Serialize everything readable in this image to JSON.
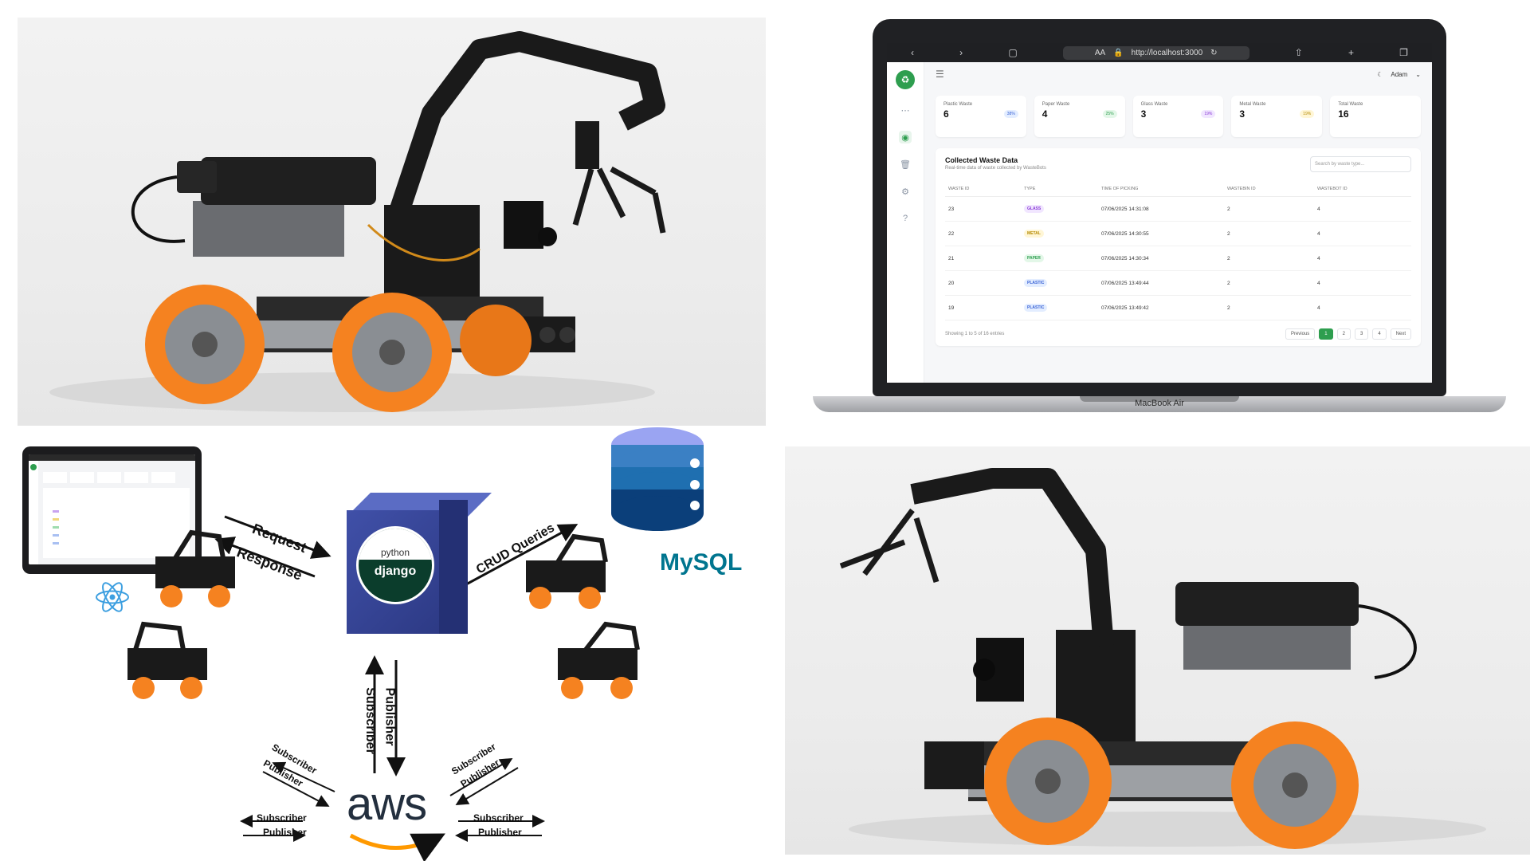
{
  "laptop": {
    "brand_label": "MacBook Air",
    "url": "http://localhost:3000",
    "url_prefix": "AA",
    "user_name": "Adam"
  },
  "dashboard": {
    "cards": [
      {
        "label": "Plastic Waste",
        "value": "6",
        "badge": "38%",
        "badge_bg": "#e3edff",
        "badge_fg": "#3a63d6"
      },
      {
        "label": "Paper Waste",
        "value": "4",
        "badge": "25%",
        "badge_bg": "#e3f7e8",
        "badge_fg": "#2e9e4f"
      },
      {
        "label": "Glass Waste",
        "value": "3",
        "badge": "19%",
        "badge_bg": "#f1e6ff",
        "badge_fg": "#8a3ad6"
      },
      {
        "label": "Metal Waste",
        "value": "3",
        "badge": "19%",
        "badge_bg": "#fff6d6",
        "badge_fg": "#b58a00"
      },
      {
        "label": "Total Waste",
        "value": "16",
        "badge": "",
        "badge_bg": "#ffffff",
        "badge_fg": "#ffffff"
      }
    ],
    "table": {
      "title": "Collected Waste Data",
      "subtitle": "Real-time data of waste collected by WasteBots",
      "search_placeholder": "Search by waste type...",
      "columns": [
        "WASTE ID",
        "TYPE",
        "TIME OF PICKING",
        "WASTEBIN ID",
        "WASTEBOT ID"
      ],
      "rows": [
        {
          "id": "23",
          "type": "GLASS",
          "type_bg": "#f1e6ff",
          "type_fg": "#8a3ad6",
          "time": "07/06/2025 14:31:08",
          "bin": "2",
          "bot": "4"
        },
        {
          "id": "22",
          "type": "METAL",
          "type_bg": "#fff6d6",
          "type_fg": "#b58a00",
          "time": "07/06/2025 14:30:55",
          "bin": "2",
          "bot": "4"
        },
        {
          "id": "21",
          "type": "PAPER",
          "type_bg": "#e3f7e8",
          "type_fg": "#2e9e4f",
          "time": "07/06/2025 14:30:34",
          "bin": "2",
          "bot": "4"
        },
        {
          "id": "20",
          "type": "PLASTIC",
          "type_bg": "#e3edff",
          "type_fg": "#3a63d6",
          "time": "07/06/2025 13:49:44",
          "bin": "2",
          "bot": "4"
        },
        {
          "id": "19",
          "type": "PLASTIC",
          "type_bg": "#e3edff",
          "type_fg": "#3a63d6",
          "time": "07/06/2025 13:49:42",
          "bin": "2",
          "bot": "4"
        }
      ],
      "footer_info": "Showing 1 to 5 of 16 entries",
      "pager": [
        "Previous",
        "1",
        "2",
        "3",
        "4",
        "Next"
      ],
      "active_page": "1"
    }
  },
  "diagram": {
    "request": "Request",
    "response": "Response",
    "crud": "CRUD Queries",
    "python": "python",
    "django": "django",
    "mysql": "MySQL",
    "aws": "aws",
    "subscriber": "Subscriber",
    "publisher": "Publisher"
  },
  "colors": {
    "accent_green": "#2e9e4f",
    "wheel_orange": "#f58220",
    "db_blue_light": "#9aa4f2",
    "db_blue_mid": "#1f6fb0",
    "db_blue_dark": "#0b3f7a",
    "mysql_blue": "#00758f",
    "mysql_orange": "#f29111",
    "aws_orange": "#ff9900"
  }
}
